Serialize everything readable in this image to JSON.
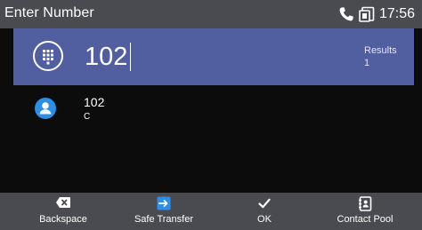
{
  "status_bar": {
    "title": "Enter Number",
    "time": "17:56",
    "icons": [
      "phone-icon",
      "phone-screen-icon"
    ]
  },
  "search": {
    "value": "102",
    "results_label": "Results",
    "results_count": "1",
    "icon": "dialpad-icon"
  },
  "contacts": [
    {
      "name": "102",
      "subtitle": "C",
      "icon": "person-avatar-icon"
    }
  ],
  "softkeys": [
    {
      "label": "Backspace",
      "icon": "backspace-icon"
    },
    {
      "label": "Safe Transfer",
      "icon": "transfer-icon"
    },
    {
      "label": "OK",
      "icon": "checkmark-icon"
    },
    {
      "label": "Contact Pool",
      "icon": "contact-book-icon"
    }
  ],
  "colors": {
    "status_bar": "#4a4b50",
    "search_row": "#515ea0",
    "background": "#0c0c0d",
    "avatar": "#2d8ee2",
    "transfer_icon": "#2f8fe6"
  }
}
